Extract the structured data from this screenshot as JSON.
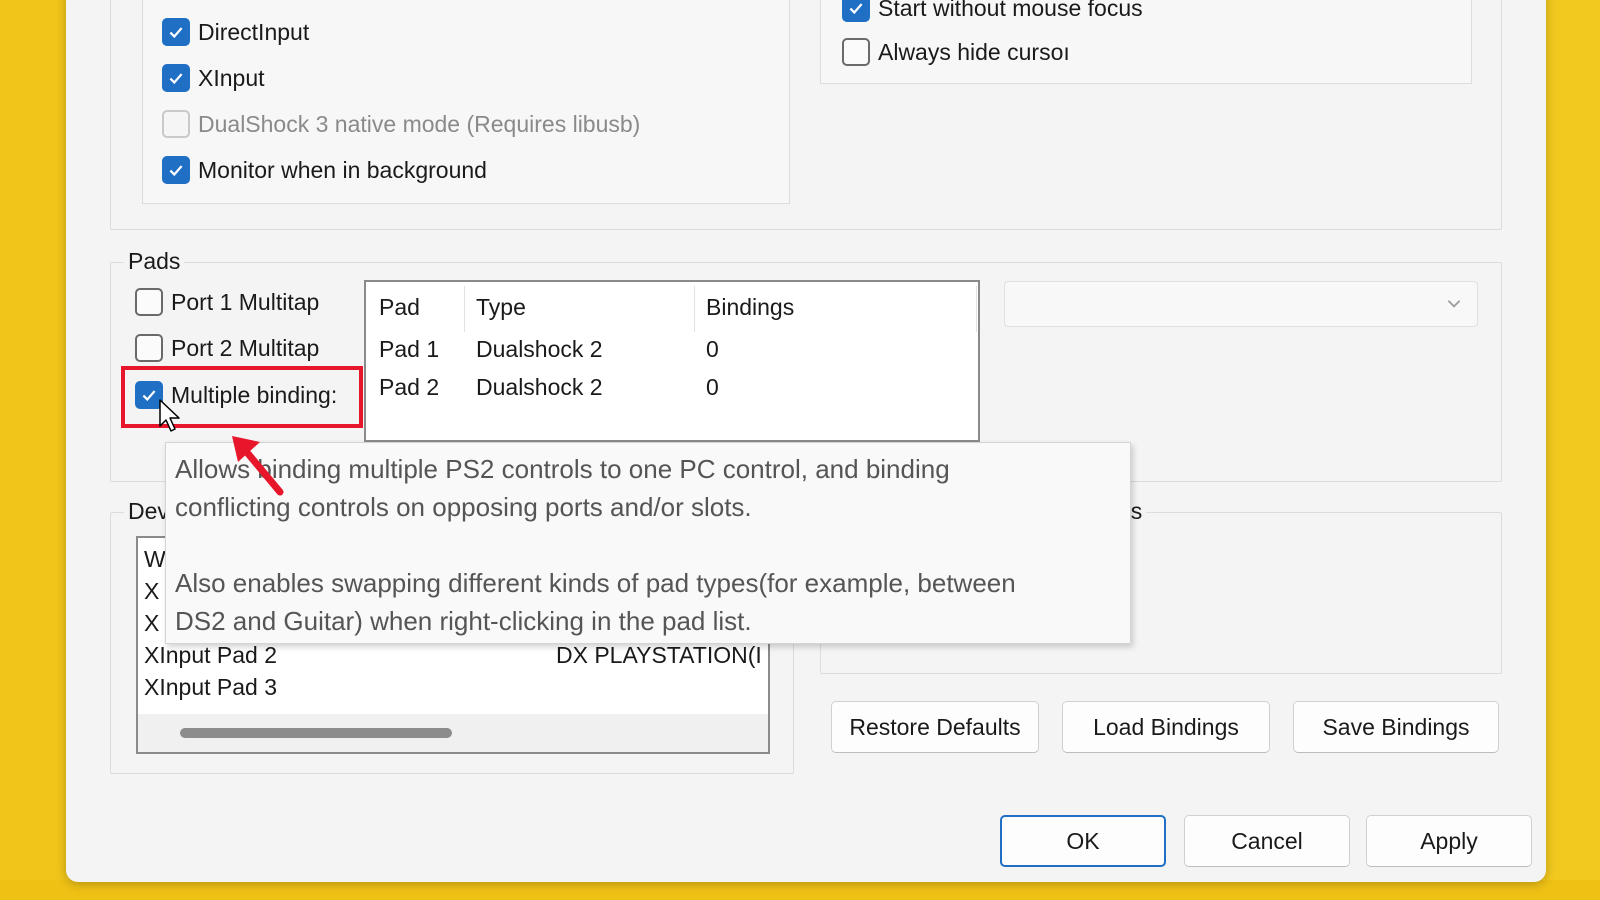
{
  "colors": {
    "background_yellow": "#f2c91f",
    "checkbox_accent": "#1f6fc5",
    "highlight_red": "#e8162b"
  },
  "top_left_group": {
    "checkboxes": [
      {
        "label": "DirectInput",
        "checked": true,
        "enabled": true
      },
      {
        "label": "XInput",
        "checked": true,
        "enabled": true
      },
      {
        "label": "DualShock 3 native mode (Requires libusb)",
        "checked": false,
        "enabled": false
      },
      {
        "label": "Monitor when in background",
        "checked": true,
        "enabled": true
      }
    ]
  },
  "top_right_group": {
    "checkboxes": [
      {
        "label": "Start without mouse focus",
        "checked": true
      },
      {
        "label": "Always hide cursoı",
        "checked": false
      }
    ]
  },
  "pads": {
    "legend": "Pads",
    "checkboxes": [
      {
        "label": "Port 1 Multitap",
        "checked": false
      },
      {
        "label": "Port 2 Multitap",
        "checked": false
      },
      {
        "label": "Multiple binding:",
        "checked": true
      }
    ],
    "table": {
      "headers": [
        "Pad",
        "Type",
        "Bindings"
      ],
      "rows": [
        [
          "Pad 1",
          "Dualshock 2",
          "0"
        ],
        [
          "Pad 2",
          "Dualshock 2",
          "0"
        ]
      ]
    },
    "combo_value": ""
  },
  "devices": {
    "legend_partial": "Dev",
    "rows": [
      {
        "name": "W",
        "info": ""
      },
      {
        "name": "X",
        "info": ""
      },
      {
        "name": "X",
        "info": ""
      },
      {
        "name": "XInput Pad 2",
        "info": "DX PLAYSTATION(I"
      },
      {
        "name": "XInput Pad 3",
        "info": ""
      }
    ]
  },
  "right_group_legend_partial": "es",
  "tooltip": {
    "paragraph1_line1": "Allows binding multiple PS2 controls to one PC control, and binding",
    "paragraph1_line2": "conflicting controls on opposing ports and/or slots.",
    "paragraph2_line1": "Also enables swapping different kinds of pad types(for example, between",
    "paragraph2_line2": "DS2 and Guitar) when right-clicking in the pad list."
  },
  "binding_buttons": {
    "restore": "Restore Defaults",
    "load": "Load Bindings",
    "save": "Save Bindings"
  },
  "dialog_buttons": {
    "ok": "OK",
    "cancel": "Cancel",
    "apply": "Apply"
  },
  "icons": {
    "check": "checkmark-icon",
    "dropdown": "chevron-down-icon",
    "pointer": "mouse-cursor-icon",
    "annotation": "red-arrow-icon"
  }
}
